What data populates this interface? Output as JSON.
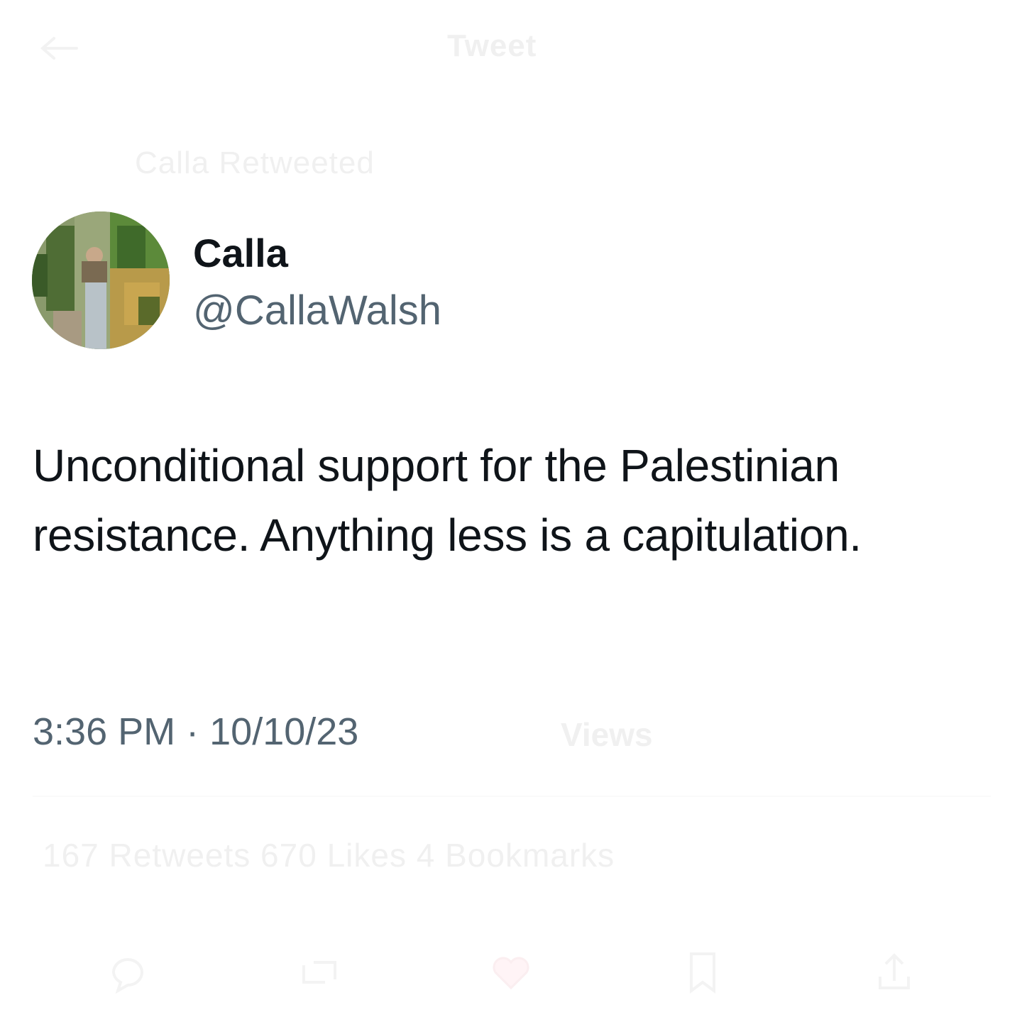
{
  "header": {
    "back_icon": "back-arrow-icon",
    "title": "Tweet"
  },
  "social_context": "Calla Retweeted",
  "author": {
    "display_name": "Calla",
    "handle": "@CallaWalsh",
    "avatar_icon": "avatar-photo"
  },
  "tweet": {
    "text": "Unconditional support for the Palestinian resistance. Anything less is a capitulation.",
    "time": "3:36 PM",
    "separator": "·",
    "date": "10/10/23",
    "views_label": "Views"
  },
  "stats": {
    "text": "167 Retweets 670 Likes 4 Bookmarks"
  },
  "actions": [
    {
      "name": "reply-icon"
    },
    {
      "name": "retweet-icon"
    },
    {
      "name": "like-icon"
    },
    {
      "name": "bookmark-icon"
    },
    {
      "name": "share-icon"
    }
  ],
  "colors": {
    "text_primary": "#0f1419",
    "text_secondary": "#536471",
    "faded_chrome": "#f0f0f0",
    "background": "#ffffff"
  }
}
